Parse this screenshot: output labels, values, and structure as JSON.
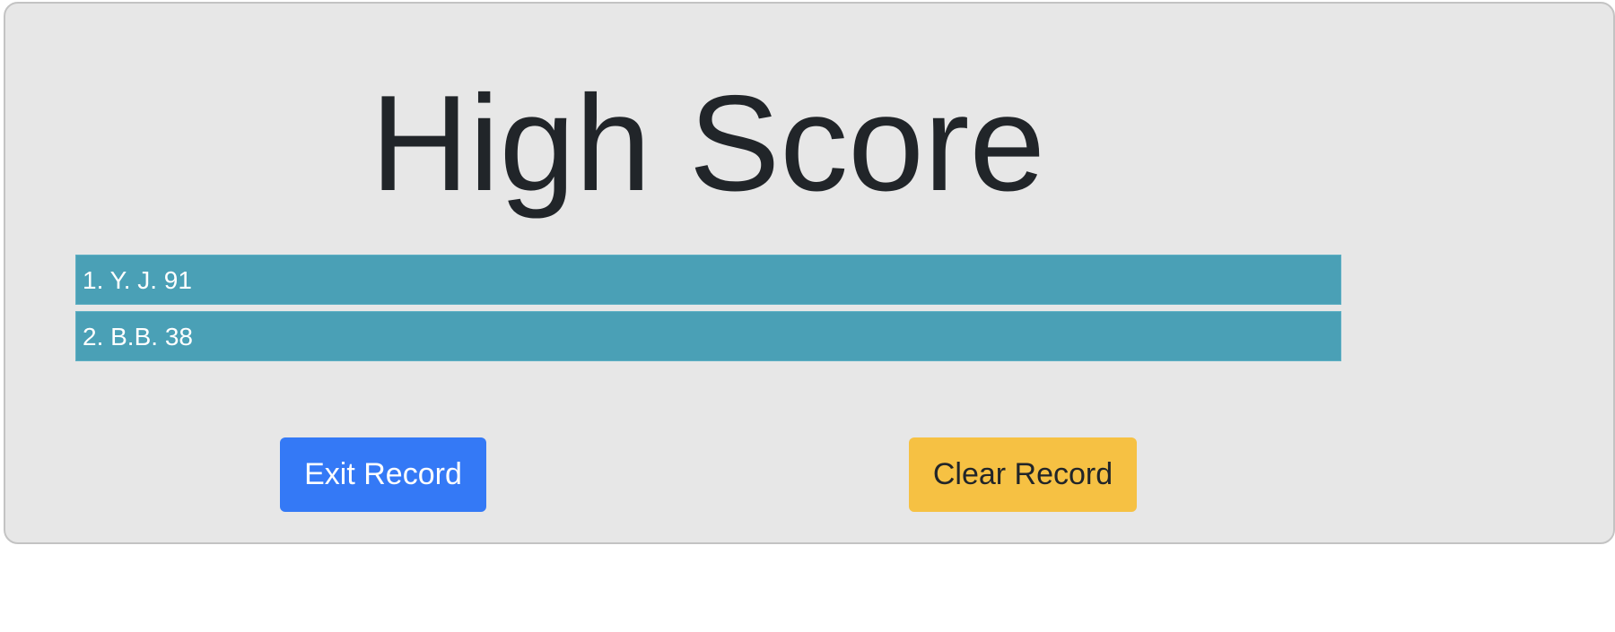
{
  "page": {
    "title": "High Score"
  },
  "scores": [
    {
      "text": "1. Y. J. 91"
    },
    {
      "text": "2. B.B. 38"
    }
  ],
  "buttons": {
    "exit_label": "Exit Record",
    "clear_label": "Clear Record"
  },
  "colors": {
    "card_background": "#e7e7e7",
    "score_row": "#4aa0b6",
    "exit_button": "#3479f6",
    "clear_button": "#f6c143",
    "title_text": "#212529"
  }
}
